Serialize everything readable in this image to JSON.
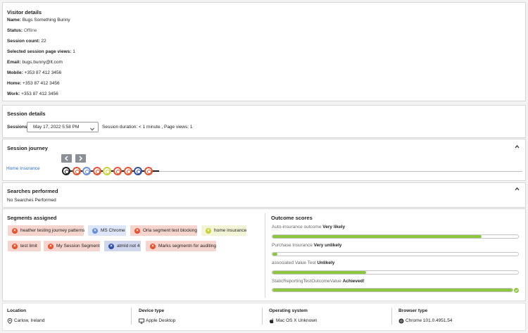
{
  "visitor": {
    "title": "Visitor details",
    "fields": [
      {
        "label": "Name:",
        "value": "Bugs Something Bunny"
      },
      {
        "label": "Status:",
        "value": "Offline"
      },
      {
        "label": "Session count:",
        "value": "22"
      },
      {
        "label": "Selected session page views:",
        "value": "1"
      },
      {
        "label": "Email:",
        "value": "bugs.bunny@lt.com"
      },
      {
        "label": "Mobile:",
        "value": "+353 87 412 3456"
      },
      {
        "label": "Home:",
        "value": "+353 87 412 3456"
      },
      {
        "label": "Work:",
        "value": "+353 87 412 3456"
      }
    ]
  },
  "session": {
    "title": "Session details",
    "sessions_label": "Sessions",
    "selected": "May 17, 2022 5:58 PM",
    "summary": "Session duration: < 1 minute , Page views: 1"
  },
  "journey": {
    "title": "Session journey",
    "page_label": "Home Insurance",
    "node_colors": [
      "#222222",
      "#e8512e",
      "#6b8fd6",
      "#e8512e",
      "#c8d23c",
      "#e8512e",
      "#e8512e",
      "#2e4fa8",
      "#e8512e"
    ]
  },
  "searches": {
    "title": "Searches performed",
    "empty": "No Searches Performed"
  },
  "segments": {
    "title": "Segments assigned",
    "items": [
      {
        "label": "heather testing journey patterns",
        "bg": "#f6d5ce",
        "dot": "#e8512e"
      },
      {
        "label": "MS Chrome",
        "bg": "#dce6f8",
        "dot": "#6b8fd6"
      },
      {
        "label": "Orla segment test blocking",
        "bg": "#f6d5ce",
        "dot": "#e8512e"
      },
      {
        "label": "home insurance",
        "bg": "#f4f5d6",
        "dot": "#c8d23c"
      },
      {
        "label": "test limit",
        "bg": "#f6d5ce",
        "dot": "#e8512e"
      },
      {
        "label": "My Session Segment",
        "bg": "#f6d5ce",
        "dot": "#e8512e"
      },
      {
        "label": "atmId not 4",
        "bg": "#cfd6ee",
        "dot": "#2e4fa8"
      },
      {
        "label": "Marks segmentn for auditing",
        "bg": "#f6d5ce",
        "dot": "#e8512e"
      }
    ]
  },
  "outcomes": {
    "title": "Outcome scores",
    "items": [
      {
        "name": "Auto-insurance outcome",
        "result": "Very likely",
        "fill": 0.85
      },
      {
        "name": "Purchase Insurance",
        "result": "Very unlikely",
        "fill": 0.02
      },
      {
        "name": "associated Value Test",
        "result": "Unlikely",
        "fill": 0.38
      },
      {
        "name": "StaticReportingTestOutcomeValue",
        "result": "Achieved!",
        "fill": 1.0
      }
    ]
  },
  "footer": {
    "location": {
      "title": "Location",
      "value": "Carlow, Ireland"
    },
    "device": {
      "title": "Device type",
      "value": "Apple Desktop"
    },
    "os": {
      "title": "Operating system",
      "value": "Mac OS X Unknown"
    },
    "browser": {
      "title": "Browser type",
      "value": "Chrome 101.0.4951.54"
    }
  },
  "colors": {
    "accent_green": "#8dc63f",
    "link_blue": "#2a6fd1",
    "nav_button": "#8a8f98"
  }
}
